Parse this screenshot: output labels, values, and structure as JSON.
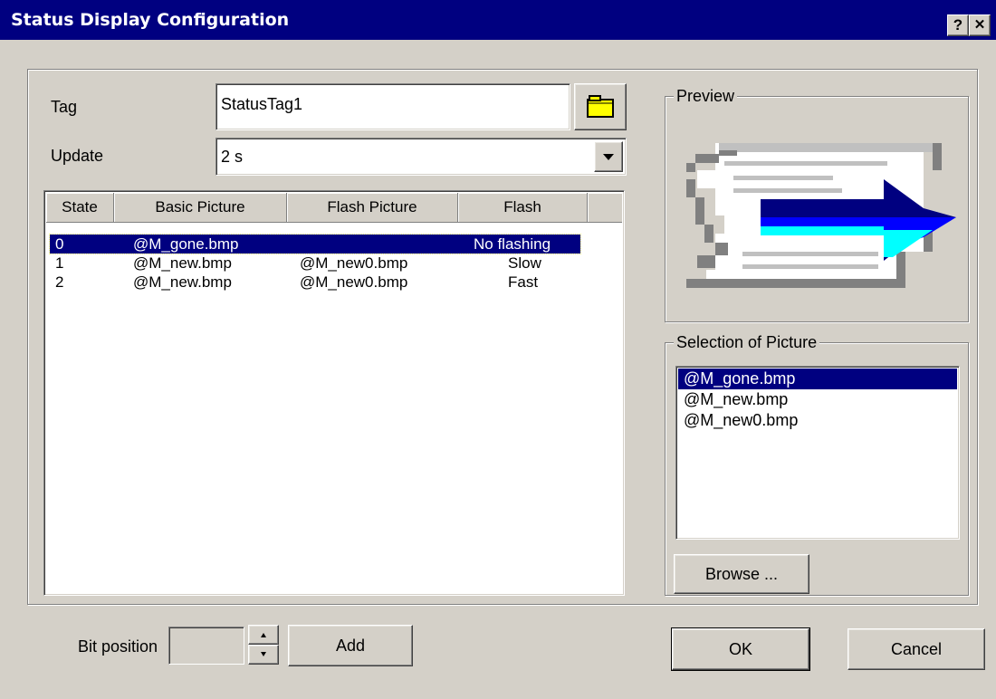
{
  "window": {
    "title": "Status Display Configuration",
    "help_icon": "?",
    "close_icon": "✕"
  },
  "form": {
    "tag_label": "Tag",
    "tag_value": "StatusTag1",
    "tag_browse_icon": "folder-icon",
    "update_label": "Update",
    "update_value": "2 s"
  },
  "table": {
    "columns": [
      "State",
      "Basic Picture",
      "Flash Picture",
      "Flash"
    ],
    "rows": [
      {
        "state": "0",
        "basic": "@M_gone.bmp",
        "flash_pic": "",
        "flash": "No flashing",
        "selected": true
      },
      {
        "state": "1",
        "basic": "@M_new.bmp",
        "flash_pic": "@M_new0.bmp",
        "flash": "Slow",
        "selected": false
      },
      {
        "state": "2",
        "basic": "@M_new.bmp",
        "flash_pic": "@M_new0.bmp",
        "flash": "Fast",
        "selected": false
      }
    ]
  },
  "preview": {
    "label": "Preview",
    "colors": {
      "arrow_dark": "#000080",
      "arrow_blue": "#0000ff",
      "arrow_cyan": "#00ffff",
      "gray": "#808080"
    }
  },
  "selection": {
    "label": "Selection of Picture",
    "items": [
      "@M_gone.bmp",
      "@M_new.bmp",
      "@M_new0.bmp"
    ],
    "selected_index": 0,
    "browse_label": "Browse ..."
  },
  "bottom": {
    "bit_position_label": "Bit position",
    "bit_position_value": "",
    "add_label": "Add",
    "ok_label": "OK",
    "cancel_label": "Cancel"
  }
}
